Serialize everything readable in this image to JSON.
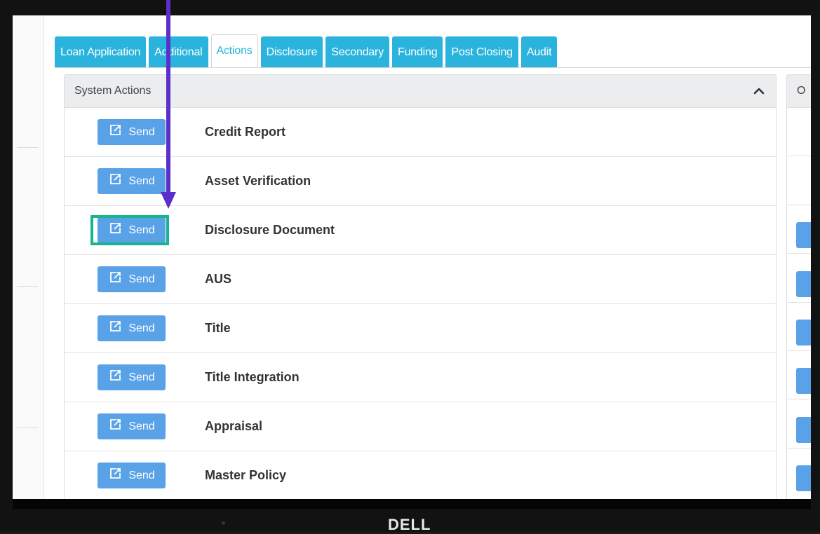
{
  "tabs": [
    {
      "label": "Loan Application",
      "active": false
    },
    {
      "label": "Additional",
      "active": false
    },
    {
      "label": "Actions",
      "active": true
    },
    {
      "label": "Disclosure",
      "active": false
    },
    {
      "label": "Secondary",
      "active": false
    },
    {
      "label": "Funding",
      "active": false
    },
    {
      "label": "Post Closing",
      "active": false
    },
    {
      "label": "Audit",
      "active": false
    }
  ],
  "system_actions": {
    "title": "System Actions",
    "button_label": "Send",
    "items": [
      "Credit Report",
      "Asset Verification",
      "Disclosure Document",
      "AUS",
      "Title",
      "Title Integration",
      "Appraisal",
      "Master Policy"
    ],
    "highlighted_index": 2
  },
  "second_panel": {
    "title_visible": "O"
  },
  "brand": {
    "logo_text": "DELL"
  },
  "colors": {
    "tab_bg": "#2ab4dd",
    "send_button": "#5aa2e8",
    "highlight_border": "#17b58b",
    "arrow": "#5b2fc9",
    "panel_header": "#ebedee"
  },
  "icons": {
    "send": "external-link-icon",
    "collapse": "chevron-up-icon"
  }
}
